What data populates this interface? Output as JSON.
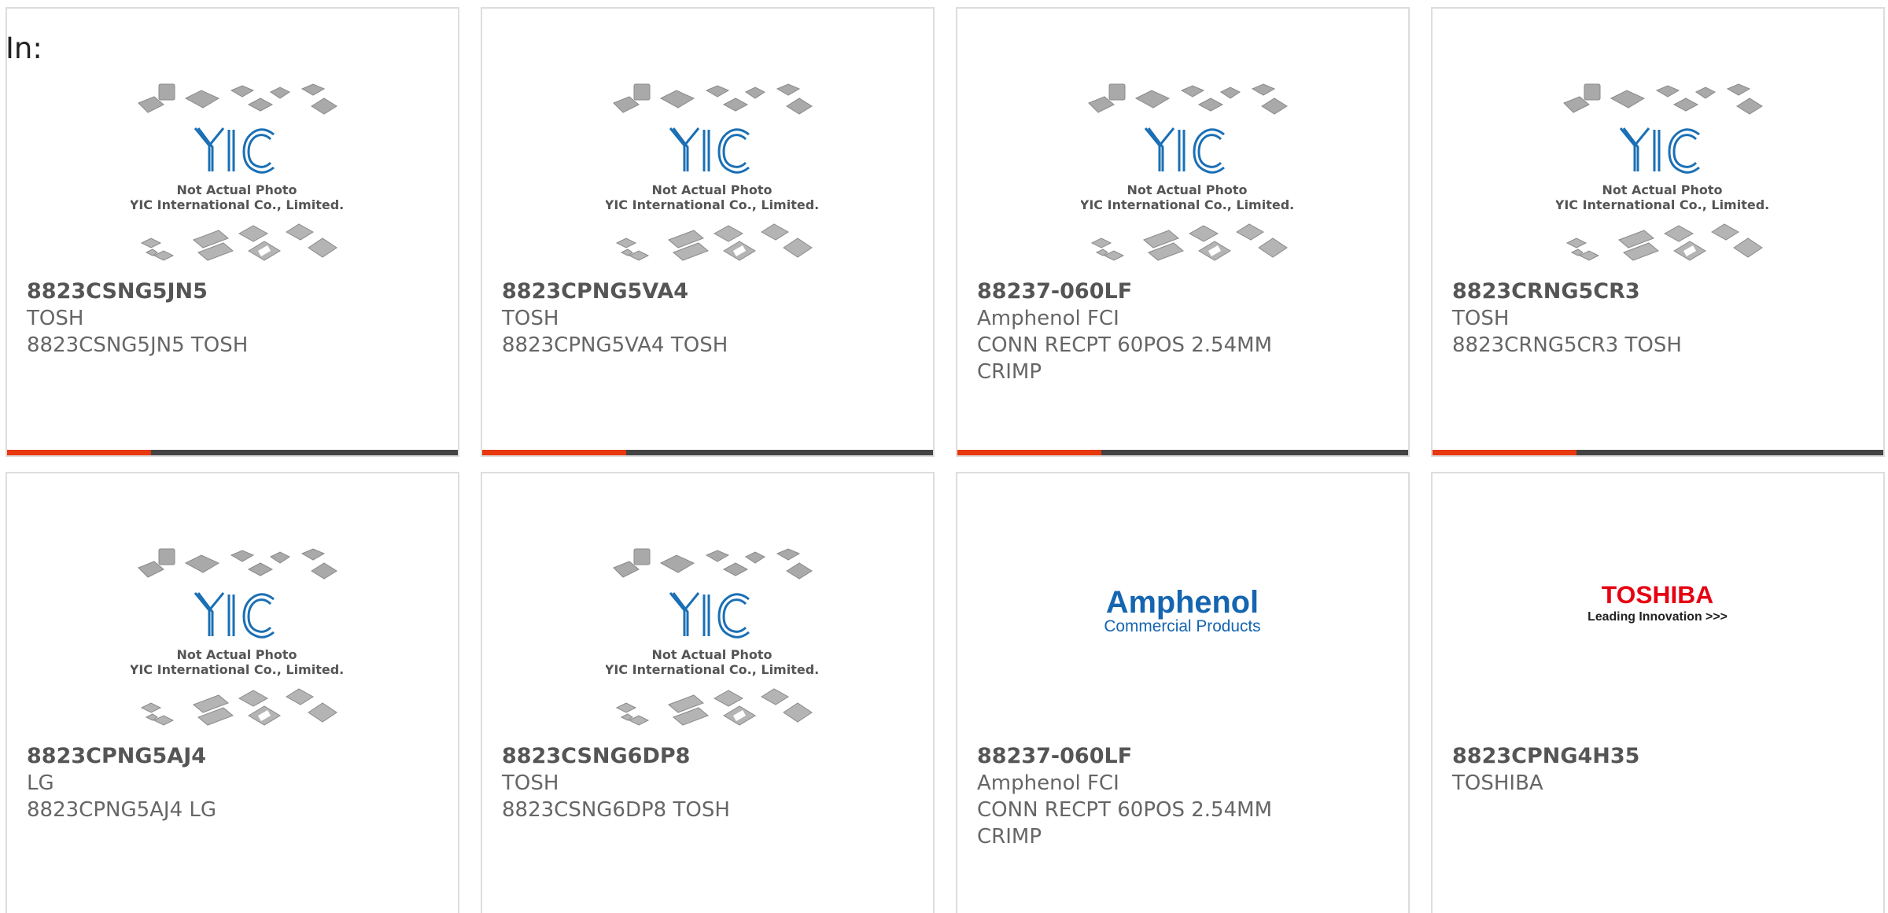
{
  "filter_label": "In:",
  "placeholder_image": {
    "line1": "Not Actual Photo",
    "line2": "YIC International Co., Limited.",
    "logo_text": "YIC"
  },
  "brand_logos": {
    "amphenol_top": "Amphenol",
    "amphenol_bottom": "Commercial Products",
    "toshiba_top": "TOSHIBA",
    "toshiba_bottom": "Leading Innovation >>>"
  },
  "colors": {
    "accent": "#e8380d",
    "bar": "#444444",
    "yic_blue": "#1a6fb5",
    "amphenol_blue": "#1565b0",
    "toshiba_red": "#e60012"
  },
  "products": [
    {
      "part_number": "8823CSNG5JN5",
      "manufacturer": "TOSH",
      "description": "8823CSNG5JN5 TOSH",
      "image": "yic-placeholder",
      "show_bar": true
    },
    {
      "part_number": "8823CPNG5VA4",
      "manufacturer": "TOSH",
      "description": "8823CPNG5VA4 TOSH",
      "image": "yic-placeholder",
      "show_bar": true
    },
    {
      "part_number": "88237-060LF",
      "manufacturer": "Amphenol FCI",
      "description": "CONN RECPT 60POS 2.54MM CRIMP",
      "image": "yic-placeholder",
      "show_bar": true
    },
    {
      "part_number": "8823CRNG5CR3",
      "manufacturer": "TOSH",
      "description": "8823CRNG5CR3 TOSH",
      "image": "yic-placeholder",
      "show_bar": true
    },
    {
      "part_number": "8823CPNG5AJ4",
      "manufacturer": "LG",
      "description": "8823CPNG5AJ4 LG",
      "image": "yic-placeholder",
      "show_bar": false
    },
    {
      "part_number": "8823CSNG6DP8",
      "manufacturer": "TOSH",
      "description": "8823CSNG6DP8 TOSH",
      "image": "yic-placeholder",
      "show_bar": false
    },
    {
      "part_number": "88237-060LF",
      "manufacturer": "Amphenol FCI",
      "description": "CONN RECPT 60POS 2.54MM CRIMP",
      "image": "amphenol-logo",
      "show_bar": false
    },
    {
      "part_number": "8823CPNG4H35",
      "manufacturer": "TOSHIBA",
      "description": "",
      "image": "toshiba-logo",
      "show_bar": false
    }
  ]
}
